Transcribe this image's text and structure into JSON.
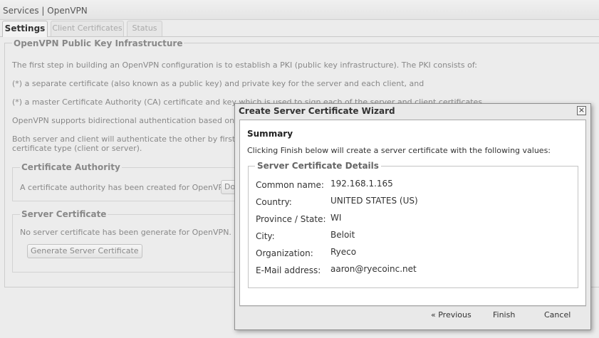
{
  "window": {
    "title": "Services | OpenVPN"
  },
  "tabs": [
    {
      "label": "Settings",
      "active": true
    },
    {
      "label": "Client Certificates",
      "active": false
    },
    {
      "label": "Status",
      "active": false
    }
  ],
  "pki": {
    "title": "OpenVPN Public Key Infrastructure",
    "para1": "The first step in building an OpenVPN configuration is to establish a PKI (public key infrastructure). The PKI consists of:",
    "para2": "(*) a separate certificate (also known as a public key) and private key for the server and each client, and",
    "para3": "(*) a master Certificate Authority (CA) certificate and key which is used to sign each of the server and client certificates.",
    "para4": "OpenVPN supports bidirectional authentication based on certificates",
    "para5_line1": "Both server and client will authenticate the other by first verifying",
    "para5_line2": "certificate type (client or server)."
  },
  "ca": {
    "title": "Certificate Authority",
    "text": "A certificate authority has been created for OpenVPN.",
    "button_partial": "Dov"
  },
  "server_cert": {
    "title": "Server Certificate",
    "text": "No server certificate has been generate for OpenVPN. Click the",
    "button": "Generate Server Certificate"
  },
  "dialog": {
    "title": "Create Server Certificate Wizard",
    "close": "×",
    "summary_title": "Summary",
    "summary_text": "Clicking Finish below will create a server certificate with the following values:",
    "details_title": "Server Certificate Details",
    "rows": [
      {
        "label": "Common name:",
        "value": "192.168.1.165"
      },
      {
        "label": "Country:",
        "value": "UNITED STATES (US)"
      },
      {
        "label": "Province / State:",
        "value": "WI"
      },
      {
        "label": "City:",
        "value": "Beloit"
      },
      {
        "label": "Organization:",
        "value": "Ryeco"
      },
      {
        "label": "E-Mail address:",
        "value": "aaron@ryecoinc.net"
      }
    ],
    "buttons": {
      "previous": "« Previous",
      "finish": "Finish",
      "cancel": "Cancel"
    }
  }
}
